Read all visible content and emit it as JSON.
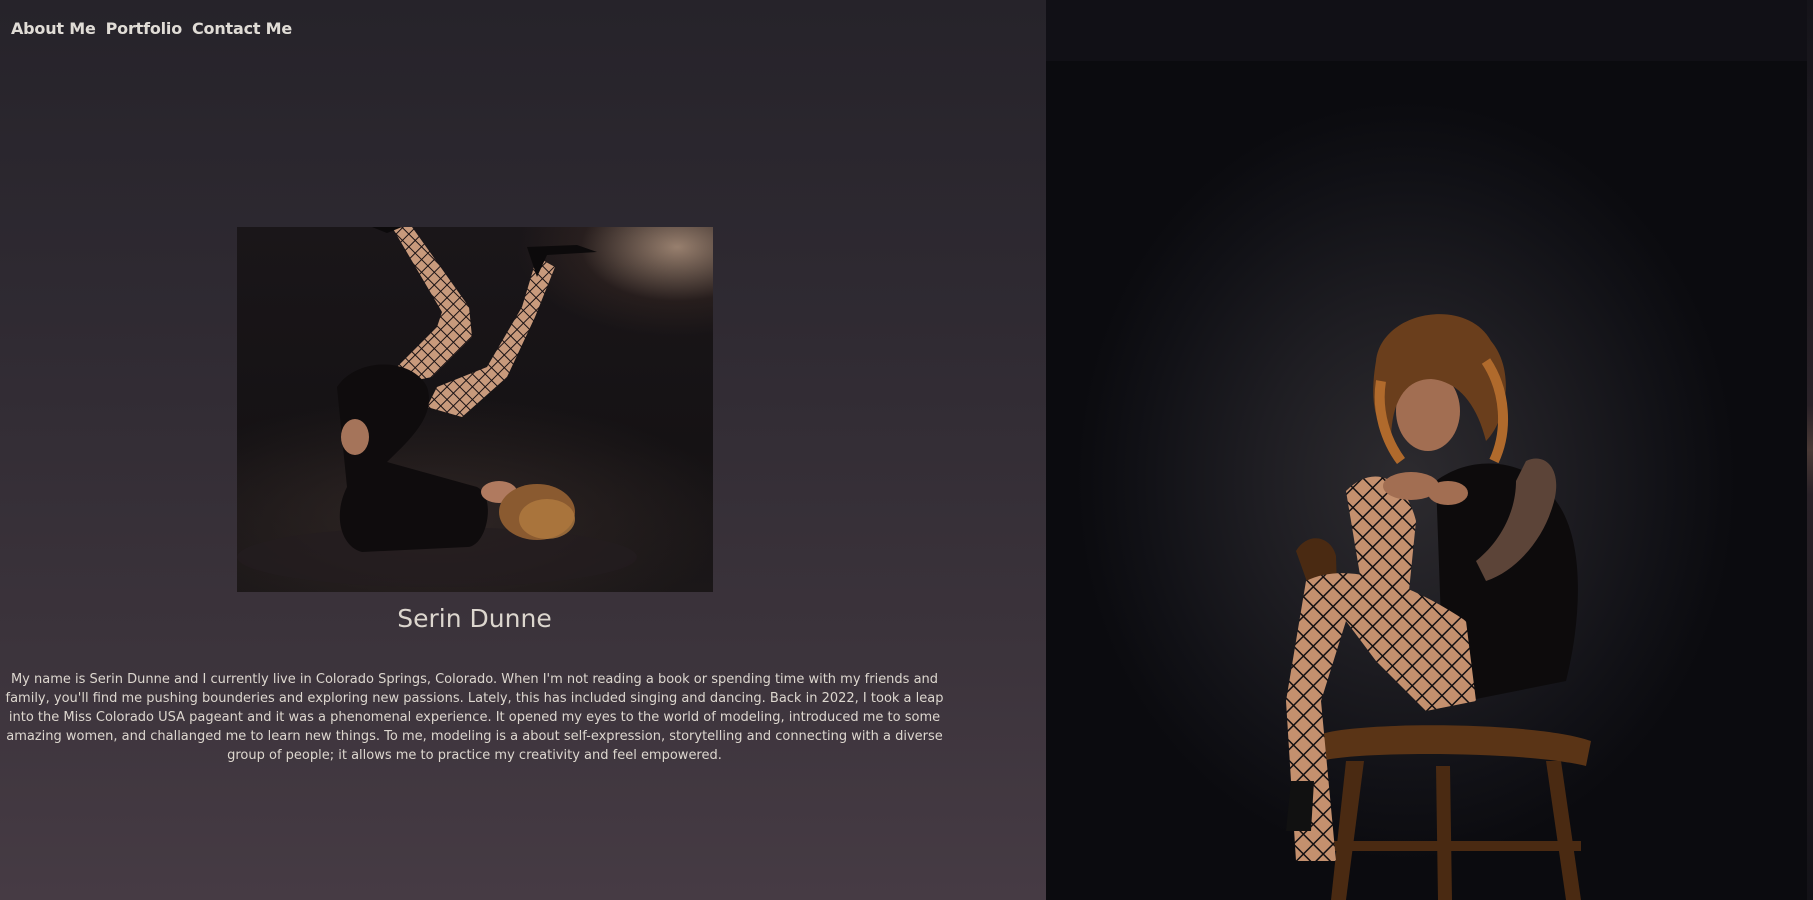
{
  "nav": {
    "items": [
      {
        "label": "About Me"
      },
      {
        "label": "Portfolio"
      },
      {
        "label": "Contact Me"
      }
    ]
  },
  "profile": {
    "name": "Serin Dunne",
    "bio": "My name is Serin Dunne and I currently live in Colorado Springs, Colorado. When I'm not reading a book or spending time with my friends and family, you'll find me pushing bounderies and exploring new passions. Lately, this has included singing and dancing. Back in 2022, I took a leap into the Miss Colorado USA pageant and it was a phenomenal experience. It opened my eyes to the world of modeling, introduced me to some amazing women, and challanged me to learn new things. To me, modeling is a about self-expression, storytelling and connecting with a diverse group of people; it allows me to practice my creativity and feel empowered."
  },
  "colors": {
    "left_gradient_top": "#26232a",
    "left_gradient_bottom": "#463b44",
    "right_background": "#0d0c10",
    "text": "#ddd7cf"
  }
}
